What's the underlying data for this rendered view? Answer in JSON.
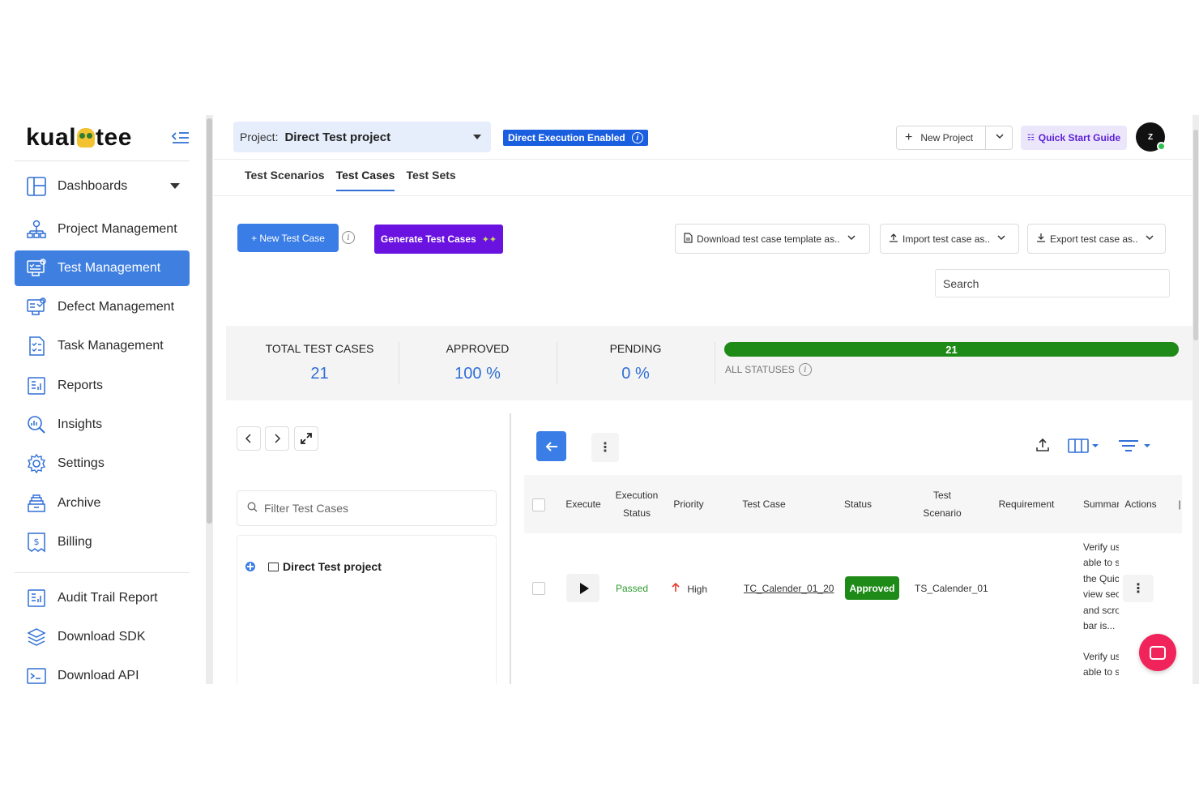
{
  "logo": {
    "text_left": "kual",
    "text_right": "tee"
  },
  "sidebar": {
    "items": [
      {
        "label": "Dashboards",
        "icon": "dashboard-icon"
      },
      {
        "label": "Project Management",
        "icon": "project-management-icon"
      },
      {
        "label": "Test Management",
        "icon": "test-management-icon",
        "active": true
      },
      {
        "label": "Defect Management",
        "icon": "defect-management-icon"
      },
      {
        "label": "Task Management",
        "icon": "task-management-icon"
      },
      {
        "label": "Reports",
        "icon": "reports-icon"
      },
      {
        "label": "Insights",
        "icon": "insights-icon"
      },
      {
        "label": "Settings",
        "icon": "settings-icon"
      },
      {
        "label": "Archive",
        "icon": "archive-icon"
      },
      {
        "label": "Billing",
        "icon": "billing-icon"
      }
    ],
    "secondary": [
      {
        "label": "Audit Trail Report",
        "icon": "audit-trail-icon"
      },
      {
        "label": "Download SDK",
        "icon": "download-sdk-icon"
      },
      {
        "label": "Download API",
        "icon": "download-api-icon"
      }
    ]
  },
  "header": {
    "project_label": "Project:",
    "project_value": "Direct Test project",
    "exec_badge": "Direct Execution Enabled",
    "new_project": "New Project",
    "quick_start": "Quick Start Guide",
    "avatar_initial": "Z"
  },
  "tabs": [
    "Test Scenarios",
    "Test Cases",
    "Test Sets"
  ],
  "toolbar": {
    "new_test_case": "+ New Test Case",
    "generate": "Generate Test Cases",
    "download_template": "Download test case template as..",
    "import": "Import test case as..",
    "export": "Export test case as..",
    "search_placeholder": "Search"
  },
  "stats": {
    "total_label": "TOTAL TEST CASES",
    "total_value": "21",
    "approved_label": "APPROVED",
    "approved_value": "100 %",
    "pending_label": "PENDING",
    "pending_value": "0 %",
    "progress_value": "21",
    "all_statuses": "ALL STATUSES"
  },
  "tree": {
    "filter_placeholder": "Filter Test Cases",
    "root": "Direct Test project"
  },
  "table": {
    "headers": {
      "execute": "Execute",
      "exec_status_1": "Execution",
      "exec_status_2": "Status",
      "priority": "Priority",
      "test_case": "Test Case",
      "status": "Status",
      "scenario_1": "Test",
      "scenario_2": "Scenario",
      "requirement": "Requirement",
      "summary": "Summary",
      "actions": "Actions"
    },
    "row": {
      "exec_status": "Passed",
      "priority": "High",
      "test_case": "TC_Calender_01_20",
      "status": "Approved",
      "scenario": "TS_Calender_01",
      "summary_lines": [
        "Verify user",
        "able to see",
        "the Quick",
        "view section",
        "and scroll",
        "bar is..."
      ],
      "summary_next": [
        "Verify user",
        "able to see"
      ]
    }
  },
  "colors": {
    "primary": "#3a7de6",
    "purple": "#6a12e0",
    "success": "#1e8a17",
    "accent_red": "#f0245a"
  }
}
